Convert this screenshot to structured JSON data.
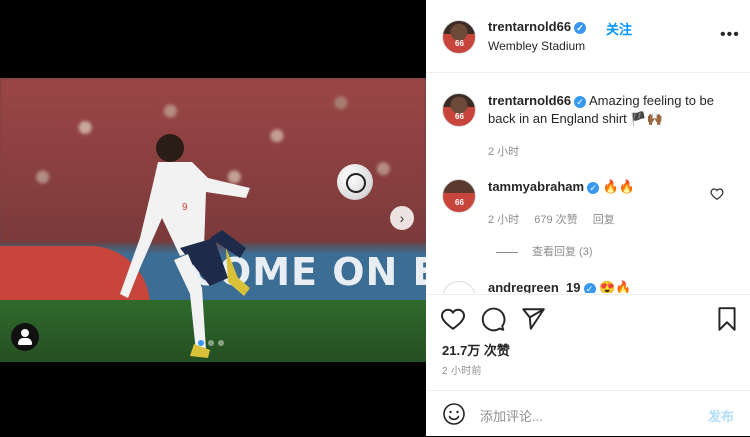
{
  "post": {
    "username": "trentarnold66",
    "follow_label": "关注",
    "location": "Wembley Stadium",
    "more_label": "•••",
    "media": {
      "banner_text": "COME ON ENG",
      "next_label": "›",
      "carousel_dots": 3,
      "active_dot": 1
    },
    "caption": {
      "username": "trentarnold66",
      "text": "Amazing feeling to be back in an England shirt 🏴🙌🏾",
      "time": "2 小时"
    },
    "comments": [
      {
        "username": "tammyabraham",
        "text": "🔥🔥",
        "time": "2 小时",
        "likes": "679 次赞",
        "reply_label": "回复",
        "view_replies": "查看回复 (3)"
      },
      {
        "username": "andregreen_19",
        "text": "😍🔥"
      }
    ],
    "likes": "21.7万 次赞",
    "time_ago": "2 小时前",
    "comment_placeholder": "添加评论...",
    "post_button": "发布"
  },
  "colors": {
    "verified": "#3897f0",
    "follow": "#0095f6",
    "post_disabled": "#b2dffc"
  }
}
